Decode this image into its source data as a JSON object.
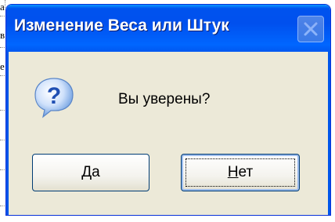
{
  "background": {
    "cell_fragments": [
      "а",
      "в",
      "е"
    ]
  },
  "dialog": {
    "title": "Изменение Веса или Штук",
    "close_icon": "close-icon",
    "message_icon": "question-icon",
    "message": "Вы уверены?",
    "buttons": {
      "yes": {
        "mnemonic": "Д",
        "rest": "а",
        "label": "Да"
      },
      "no": {
        "mnemonic": "Н",
        "rest": "ет",
        "label": "Нет"
      }
    }
  },
  "colors": {
    "titlebar": "#0058f0",
    "dialog_bg": "#ece9d8",
    "frame": "#0055ea"
  }
}
